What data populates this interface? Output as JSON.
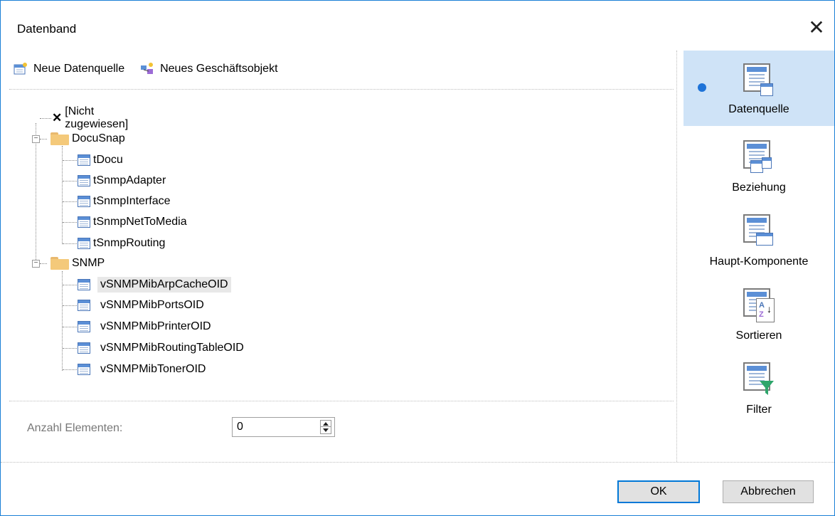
{
  "window": {
    "title": "Datenband",
    "close_symbol": "✕"
  },
  "toolbar": {
    "new_datasource": "Neue Datenquelle",
    "new_business_object": "Neues Geschäftsobjekt"
  },
  "tree": {
    "not_assigned": "[Nicht zugewiesen]",
    "groups": [
      {
        "label": "DocuSnap",
        "items": [
          "tDocu",
          "tSnmpAdapter",
          "tSnmpInterface",
          "tSnmpNetToMedia",
          "tSnmpRouting"
        ]
      },
      {
        "label": "SNMP",
        "items": [
          "vSNMPMibArpCacheOID",
          "vSNMPMibPortsOID",
          "vSNMPMibPrinterOID",
          "vSNMPMibRoutingTableOID",
          "vSNMPMibTonerOID"
        ]
      }
    ],
    "selected": "vSNMPMibArpCacheOID"
  },
  "count": {
    "label": "Anzahl Elementen:",
    "value": "0"
  },
  "side_panel": {
    "items": [
      {
        "label": "Datenquelle",
        "icon": "datasource-icon",
        "active": true
      },
      {
        "label": "Beziehung",
        "icon": "relation-icon",
        "active": false
      },
      {
        "label": "Haupt-Komponente",
        "icon": "master-component-icon",
        "active": false
      },
      {
        "label": "Sortieren",
        "icon": "sort-icon",
        "active": false
      },
      {
        "label": "Filter",
        "icon": "filter-icon",
        "active": false
      }
    ]
  },
  "buttons": {
    "ok": "OK",
    "cancel": "Abbrechen"
  },
  "colors": {
    "accent": "#0078d7",
    "active_panel": "#cfe3f7",
    "folder": "#f4c97a"
  }
}
